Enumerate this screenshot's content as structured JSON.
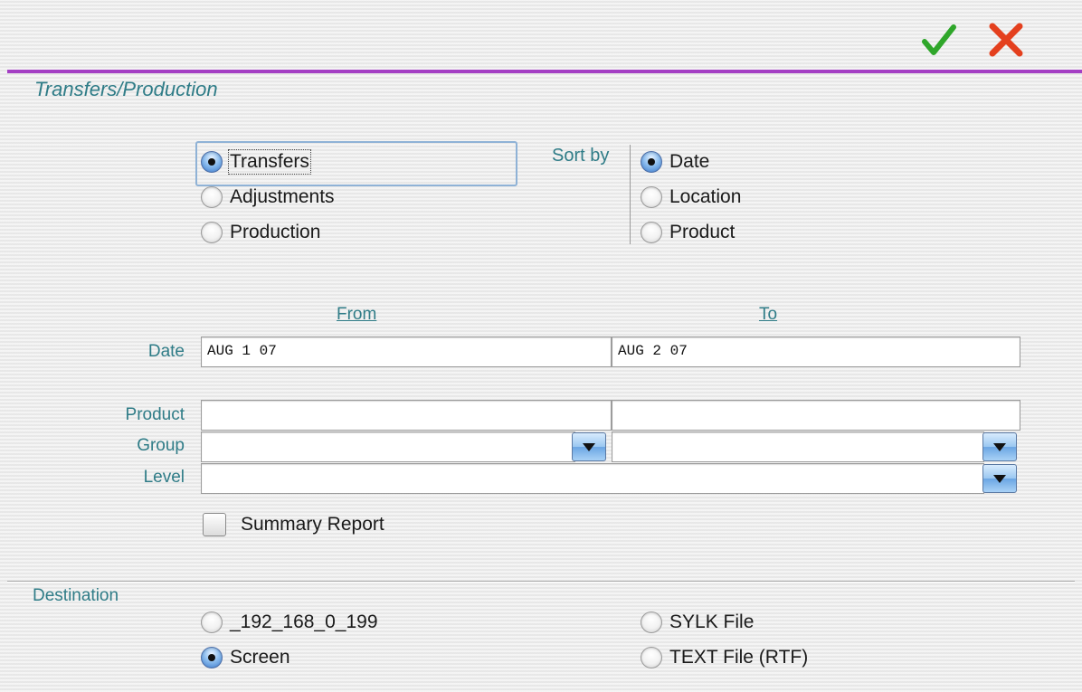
{
  "toolbar": {
    "ok_icon": "checkmark-icon",
    "cancel_icon": "close-icon",
    "ok_color": "#2fa62a",
    "cancel_color": "#e4401e"
  },
  "accent_color": "#a43fc4",
  "title": "Transfers/Production",
  "report_type": {
    "options": [
      {
        "label": "Transfers",
        "selected": true
      },
      {
        "label": "Adjustments",
        "selected": false
      },
      {
        "label": "Production",
        "selected": false
      }
    ]
  },
  "sort": {
    "label": "Sort by",
    "options": [
      {
        "label": "Date",
        "selected": true
      },
      {
        "label": "Location",
        "selected": false
      },
      {
        "label": "Product",
        "selected": false
      }
    ]
  },
  "range": {
    "from_label": "From",
    "to_label": "To"
  },
  "fields": {
    "date_label": "Date",
    "date_from": "AUG 1 07",
    "date_to": "AUG 2 07",
    "product_label": "Product",
    "product_from": "",
    "product_to": "",
    "group_label": "Group",
    "group_from": "",
    "group_to": "",
    "level_label": "Level",
    "level_value": ""
  },
  "summary_report": {
    "label": "Summary Report",
    "checked": false
  },
  "destination": {
    "label": "Destination",
    "options": [
      {
        "label": "_192_168_0_199",
        "selected": false
      },
      {
        "label": "Screen",
        "selected": true
      },
      {
        "label": "SYLK File",
        "selected": false
      },
      {
        "label": "TEXT File (RTF)",
        "selected": false
      }
    ]
  }
}
